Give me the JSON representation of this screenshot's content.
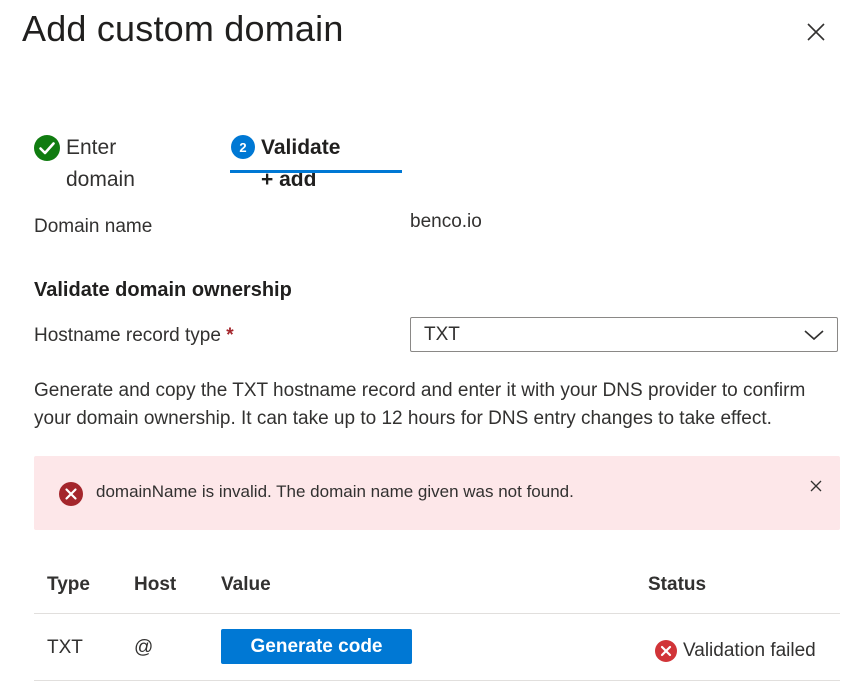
{
  "panel": {
    "title": "Add custom domain"
  },
  "steps": [
    {
      "label": "Enter domain",
      "state": "complete"
    },
    {
      "label": "Validate + add",
      "number": "2",
      "state": "active"
    }
  ],
  "domain": {
    "label": "Domain name",
    "value": "benco.io"
  },
  "validation": {
    "section_title": "Validate domain ownership",
    "record_type_label": "Hostname record type",
    "required_marker": "*",
    "record_type_value": "TXT",
    "description": "Generate and copy the TXT hostname record and enter it with your DNS provider to confirm your domain ownership. It can take up to 12 hours for DNS entry changes to take effect."
  },
  "error": {
    "message": "domainName is invalid.  The domain name given was not found."
  },
  "table": {
    "headers": {
      "type": "Type",
      "host": "Host",
      "value": "Value",
      "status": "Status"
    },
    "rows": [
      {
        "type": "TXT",
        "host": "@",
        "button_label": "Generate code",
        "status": "Validation failed"
      }
    ]
  },
  "colors": {
    "accent": "#0078d4",
    "success": "#107c10",
    "error": "#d13438",
    "error_background": "#fde7e9"
  },
  "icons": {
    "close": "close-icon",
    "step_complete": "checkmark-circle-icon",
    "dropdown": "chevron-down-icon",
    "error": "error-badge-icon",
    "status_failed": "error-badge-icon"
  }
}
